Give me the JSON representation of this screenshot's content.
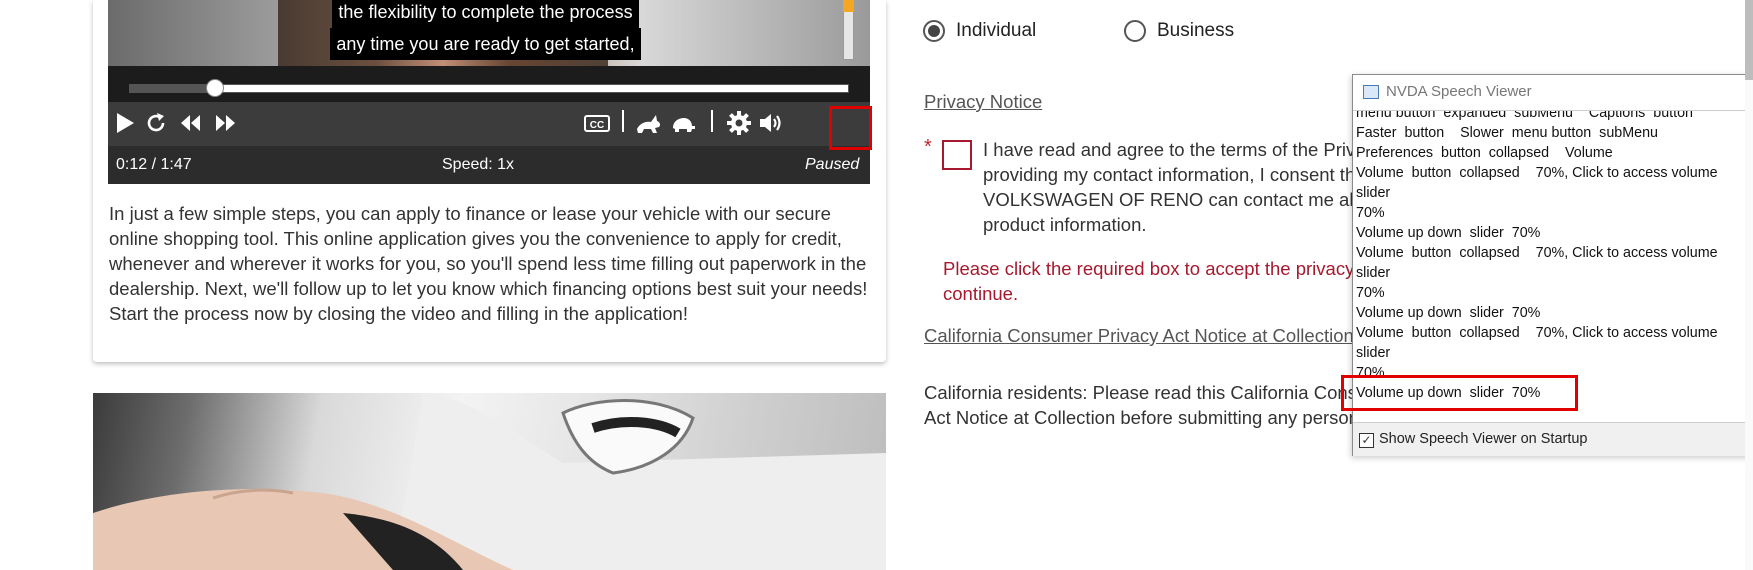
{
  "video": {
    "caption_line1": "the flexibility to complete the process",
    "caption_line2": "any time you are ready to get started,",
    "current_time": "0:12",
    "duration": "1:47",
    "time_display": "0:12 / 1:47",
    "speed_label": "Speed: 1x",
    "state_label": "Paused",
    "progress_fraction": 0.112,
    "volume_percent": 70,
    "controls": [
      "play-icon",
      "replay-icon",
      "rewind-icon",
      "fast-forward-icon",
      "closed-captions-icon",
      "faster-hare-icon",
      "slower-turtle-icon",
      "settings-gear-icon",
      "volume-icon"
    ]
  },
  "description": "In just a few simple steps, you can apply to finance or lease your vehicle with our secure online shopping tool. This online application gives you the convenience to apply for credit, whenever and wherever it works for you, so you'll spend less time filling out paperwork in the dealership. Next, we'll follow up to let you know which financing options best suit your needs! Start the process now by closing the video and filling in the application!",
  "form": {
    "radio_individual": "Individual",
    "radio_business": "Business",
    "selected": "Individual",
    "privacy_notice_link": "Privacy Notice",
    "required_marker": "*",
    "consent_text": "I have read and agree to the terms of the Priv providing my contact information, I consent th VOLKSWAGEN OF RENO can contact me abou product information.",
    "error_text": "Please click the required box to accept the privacy continue.",
    "ccpa_link": "California Consumer Privacy Act Notice at Collection",
    "ccpa_text": "California residents: Please read this California Consu Act Notice at Collection before submitting any persor",
    "error_color": "#a6192e"
  },
  "nvda": {
    "title": "NVDA Speech Viewer",
    "close": "✕",
    "lines": [
      "menu button  expanded  subMenu    Captions  button",
      "Faster  button    Slower  menu button  subMenu",
      "Preferences  button  collapsed    Volume",
      "Volume  button  collapsed    70%, Click to access volume slider",
      "70%",
      "Volume up down  slider  70%",
      "Volume  button  collapsed    70%, Click to access volume slider",
      "70%",
      "Volume up down  slider  70%",
      "Volume  button  collapsed    70%, Click to access volume slider",
      "70%",
      "Volume up down  slider  70%"
    ],
    "checkbox_label": "Show Speech Viewer on Startup",
    "checkbox_checked": true
  },
  "highlight_color": "#e00000"
}
